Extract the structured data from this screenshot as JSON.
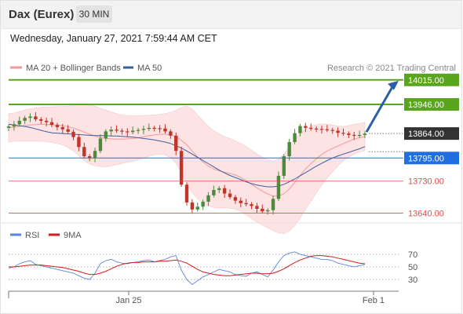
{
  "header": {
    "title": "Dax (Eurex)",
    "interval": "30 MIN",
    "timestamp": "Wednesday, January 27, 2021 7:59:44 AM CET"
  },
  "legend": {
    "items": [
      {
        "label": "MA 20 + Bollinger Bands",
        "color": "#f29a9a"
      },
      {
        "label": "MA 50",
        "color": "#3a5e9f"
      }
    ],
    "credit": "Research © 2021 Trading Central"
  },
  "rsi_legend": {
    "items": [
      {
        "label": "RSI",
        "color": "#5b86d6"
      },
      {
        "label": "9MA",
        "color": "#d31c1c"
      }
    ]
  },
  "colors": {
    "candle_up": "#4f8a3c",
    "candle_down": "#c03528",
    "resistance_green": "#5aa51e",
    "current_price_box": "#333333",
    "pivot_blue": "#1f6fe0",
    "support_red": "#e34b4b",
    "arrow": "#2e5fa6",
    "bollinger_fill": "#fde3e3"
  },
  "chart_data": [
    {
      "type": "candlestick",
      "name": "price",
      "x_ticks": [
        "Jan 25",
        "Feb 1"
      ],
      "levels": [
        {
          "label": "14015.00",
          "value": 14015,
          "kind": "resistance"
        },
        {
          "label": "13946.00",
          "value": 13946,
          "kind": "resistance"
        },
        {
          "label": "13864.00",
          "value": 13864,
          "kind": "last"
        },
        {
          "label": "13795.00",
          "value": 13795,
          "kind": "pivot"
        },
        {
          "label": "13730.00",
          "value": 13730,
          "kind": "support"
        },
        {
          "label": "13640.00",
          "value": 13640,
          "kind": "support"
        }
      ],
      "ylim": [
        13610,
        14030
      ],
      "close": [
        13884,
        13890,
        13900,
        13908,
        13912,
        13904,
        13900,
        13896,
        13888,
        13882,
        13876,
        13869,
        13854,
        13826,
        13800,
        13795,
        13815,
        13850,
        13870,
        13875,
        13872,
        13870,
        13868,
        13872,
        13874,
        13877,
        13880,
        13879,
        13878,
        13870,
        13858,
        13815,
        13720,
        13670,
        13650,
        13658,
        13672,
        13690,
        13705,
        13710,
        13695,
        13685,
        13675,
        13668,
        13665,
        13660,
        13652,
        13645,
        13648,
        13680,
        13745,
        13800,
        13840,
        13865,
        13885,
        13880,
        13878,
        13877,
        13876,
        13874,
        13872,
        13866,
        13864,
        13860,
        13858,
        13860,
        13864
      ],
      "bollinger": {
        "ma20": [
          13880,
          13882,
          13884,
          13886,
          13888,
          13889,
          13890,
          13890,
          13889,
          13888,
          13886,
          13883,
          13879,
          13874,
          13868,
          13862,
          13857,
          13853,
          13850,
          13849,
          13848,
          13848,
          13849,
          13850,
          13852,
          13855,
          13858,
          13860,
          13862,
          13862,
          13860,
          13855,
          13845,
          13832,
          13815,
          13798,
          13784,
          13772,
          13764,
          13759,
          13755,
          13752,
          13747,
          13740,
          13731,
          13721,
          13711,
          13702,
          13694,
          13688,
          13688,
          13694,
          13708,
          13726,
          13746,
          13764,
          13779,
          13793,
          13805,
          13815,
          13822,
          13829,
          13836,
          13842,
          13848,
          13852,
          13856
        ],
        "band_width": [
          40,
          40,
          42,
          44,
          46,
          47,
          48,
          49,
          50,
          52,
          54,
          58,
          64,
          72,
          80,
          84,
          84,
          82,
          80,
          76,
          72,
          68,
          66,
          64,
          62,
          60,
          58,
          56,
          56,
          58,
          64,
          74,
          92,
          110,
          118,
          118,
          116,
          112,
          108,
          104,
          100,
          98,
          96,
          96,
          96,
          96,
          96,
          96,
          96,
          98,
          104,
          112,
          118,
          122,
          120,
          114,
          106,
          96,
          86,
          76,
          66,
          56,
          48,
          44,
          42,
          40,
          40
        ]
      },
      "ma50": [
        13890,
        13888,
        13886,
        13884,
        13881,
        13877,
        13873,
        13869,
        13866,
        13865,
        13864,
        13863,
        13862,
        13861,
        13860,
        13859,
        13858,
        13858,
        13858,
        13857,
        13857,
        13856,
        13855,
        13854,
        13852,
        13850,
        13848,
        13846,
        13843,
        13840,
        13836,
        13830,
        13823,
        13815,
        13806,
        13797,
        13788,
        13779,
        13770,
        13761,
        13753,
        13746,
        13740,
        13734,
        13728,
        13723,
        13719,
        13716,
        13714,
        13714,
        13716,
        13721,
        13728,
        13736,
        13745,
        13754,
        13763,
        13772,
        13780,
        13788,
        13795,
        13801,
        13806,
        13811,
        13816,
        13821,
        13827
      ]
    },
    {
      "type": "line",
      "name": "RSI",
      "ylim": [
        15,
        85
      ],
      "y_ticks": [
        70,
        50,
        30
      ],
      "series": [
        {
          "name": "RSI",
          "values": [
            48,
            50,
            55,
            58,
            60,
            54,
            52,
            50,
            48,
            46,
            44,
            42,
            40,
            36,
            32,
            30,
            40,
            55,
            60,
            62,
            58,
            56,
            55,
            57,
            58,
            60,
            61,
            58,
            60,
            62,
            66,
            68,
            45,
            30,
            22,
            28,
            34,
            38,
            42,
            46,
            44,
            42,
            38,
            36,
            35,
            40,
            42,
            38,
            34,
            45,
            58,
            68,
            72,
            74,
            70,
            68,
            66,
            64,
            62,
            62,
            60,
            56,
            54,
            52,
            50,
            52,
            54
          ]
        },
        {
          "name": "9MA",
          "values": [
            50,
            50,
            51,
            52,
            53,
            53,
            53,
            52,
            51,
            50,
            49,
            47,
            45,
            43,
            40,
            38,
            38,
            40,
            43,
            47,
            51,
            54,
            56,
            57,
            57,
            58,
            58,
            58,
            59,
            59,
            60,
            61,
            59,
            56,
            51,
            46,
            42,
            40,
            38,
            37,
            36,
            36,
            37,
            38,
            39,
            40,
            40,
            39,
            39,
            40,
            43,
            47,
            52,
            57,
            61,
            64,
            67,
            68,
            68,
            67,
            66,
            64,
            62,
            60,
            58,
            56,
            55
          ]
        }
      ]
    }
  ]
}
